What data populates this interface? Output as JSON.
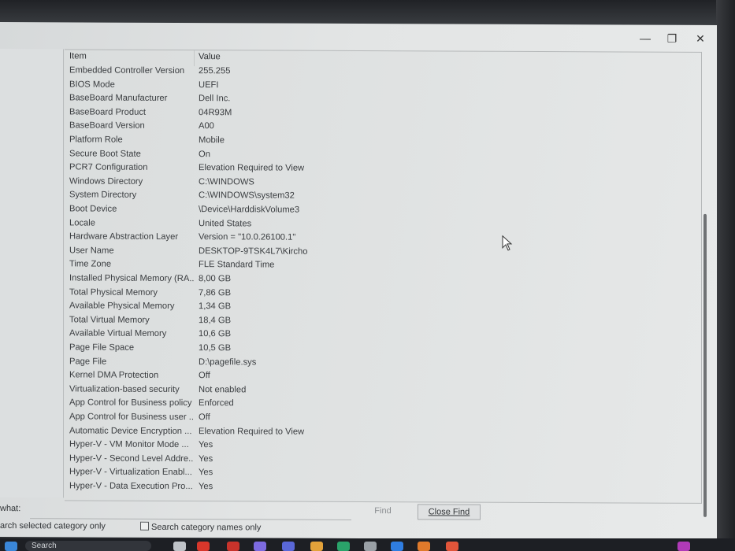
{
  "window": {
    "minimize_glyph": "—",
    "maximize_glyph": "❐",
    "close_glyph": "✕"
  },
  "grid": {
    "columns": {
      "item": "Item",
      "value": "Value"
    },
    "rows": [
      {
        "item": "Embedded Controller Version",
        "value": "255.255"
      },
      {
        "item": "BIOS Mode",
        "value": "UEFI"
      },
      {
        "item": "BaseBoard Manufacturer",
        "value": "Dell Inc."
      },
      {
        "item": "BaseBoard Product",
        "value": "04R93M"
      },
      {
        "item": "BaseBoard Version",
        "value": "A00"
      },
      {
        "item": "Platform Role",
        "value": "Mobile"
      },
      {
        "item": "Secure Boot State",
        "value": "On"
      },
      {
        "item": "PCR7 Configuration",
        "value": "Elevation Required to View"
      },
      {
        "item": "Windows Directory",
        "value": "C:\\WINDOWS"
      },
      {
        "item": "System Directory",
        "value": "C:\\WINDOWS\\system32"
      },
      {
        "item": "Boot Device",
        "value": "\\Device\\HarddiskVolume3"
      },
      {
        "item": "Locale",
        "value": "United States"
      },
      {
        "item": "Hardware Abstraction Layer",
        "value": "Version = \"10.0.26100.1\""
      },
      {
        "item": "User Name",
        "value": "DESKTOP-9TSK4L7\\Kircho"
      },
      {
        "item": "Time Zone",
        "value": "FLE Standard Time"
      },
      {
        "item": "Installed Physical Memory (RA...",
        "value": "8,00 GB"
      },
      {
        "item": "Total Physical Memory",
        "value": "7,86 GB"
      },
      {
        "item": "Available Physical Memory",
        "value": "1,34 GB"
      },
      {
        "item": "Total Virtual Memory",
        "value": "18,4 GB"
      },
      {
        "item": "Available Virtual Memory",
        "value": "10,6 GB"
      },
      {
        "item": "Page File Space",
        "value": "10,5 GB"
      },
      {
        "item": "Page File",
        "value": "D:\\pagefile.sys"
      },
      {
        "item": "Kernel DMA Protection",
        "value": "Off"
      },
      {
        "item": "Virtualization-based security",
        "value": "Not enabled"
      },
      {
        "item": "App Control for Business policy",
        "value": "Enforced"
      },
      {
        "item": "App Control for Business user ...",
        "value": "Off"
      },
      {
        "item": "Automatic Device Encryption ...",
        "value": "Elevation Required to View"
      },
      {
        "item": "Hyper-V - VM Monitor Mode ...",
        "value": "Yes"
      },
      {
        "item": "Hyper-V - Second Level Addre...",
        "value": "Yes"
      },
      {
        "item": "Hyper-V - Virtualization Enabl...",
        "value": "Yes"
      },
      {
        "item": "Hyper-V - Data Execution Pro...",
        "value": "Yes"
      }
    ]
  },
  "find": {
    "label": "what:",
    "input_value": "",
    "find_button": "Find",
    "close_find_button": "Close Find",
    "search_selected_label": "arch selected category only",
    "search_names_label": "Search category names only"
  },
  "taskbar": {
    "search_placeholder": "Search"
  },
  "colors": {
    "window_bg": "#e3e5e5",
    "taskbar_bg": "#1d1f24",
    "text": "#3a3d40"
  }
}
